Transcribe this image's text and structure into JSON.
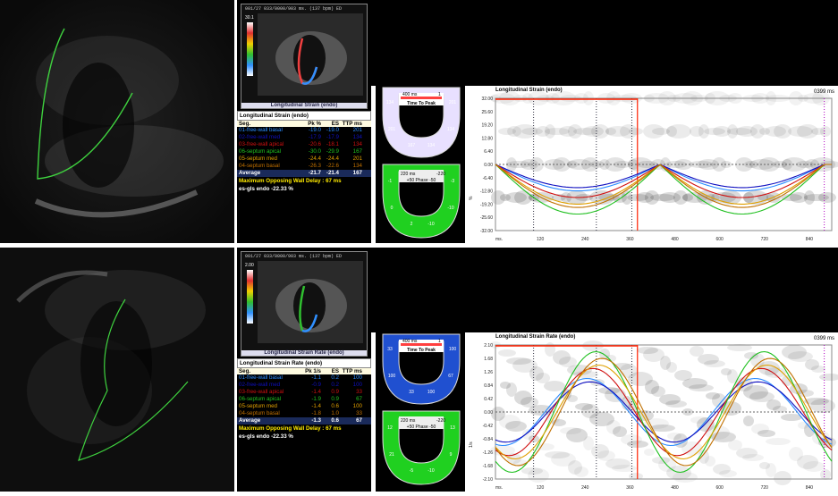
{
  "top": {
    "header": "001/27 033/0000/903 ms. (137 bpm) ED",
    "scale_label": "30.1",
    "thumb_caption": "Longitudinal Strain (endo)",
    "table": {
      "title": "Longitudinal Strain (endo)",
      "headers": [
        "Seg.",
        "Pk %",
        "ES",
        "TTP ms"
      ],
      "rows": [
        {
          "seg": "01-free-wall basal",
          "pk": "-19.0",
          "es": "-19.0",
          "ttp": "201",
          "color": "#2a8cff"
        },
        {
          "seg": "02-free-wall med",
          "pk": "-17.9",
          "es": "-17.9",
          "ttp": "134",
          "color": "#1010c0"
        },
        {
          "seg": "03-free-wall apical",
          "pk": "-20.6",
          "es": "-18.1",
          "ttp": "134",
          "color": "#d01010"
        },
        {
          "seg": "06-septum apical",
          "pk": "-30.0",
          "es": "-29.9",
          "ttp": "167",
          "color": "#20c020"
        },
        {
          "seg": "05-septum med",
          "pk": "-24.4",
          "es": "-24.4",
          "ttp": "201",
          "color": "#e0a000"
        },
        {
          "seg": "04-septum basal",
          "pk": "-26.3",
          "es": "-22.6",
          "ttp": "134",
          "color": "#c07000"
        }
      ],
      "average": {
        "label": "Average",
        "pk": "-21.7",
        "es": "-21.4",
        "ttp": "167"
      },
      "delay": "Maximum Opposing Wall Delay : 67 ms",
      "gls": "es-gls endo -22.33 %"
    },
    "bullseye1": {
      "left_label": "400 ms",
      "right_label": "1",
      "center": "Time To Peak",
      "values": [
        "134",
        "201",
        "201",
        "134",
        "167",
        "134"
      ]
    },
    "bullseye2": {
      "left_label": "220 ms",
      "right_label": "-220",
      "center": "+50 Phase -50",
      "values": [
        "-1",
        "-3",
        "0",
        "-10",
        "2",
        "-10"
      ]
    },
    "graph_title": "Longitudinal Strain (endo)",
    "graph_time": "0399 ms",
    "unit": "%",
    "x_unit": "ms.",
    "y_ticks": [
      "32.00",
      "25.60",
      "19.20",
      "12.80",
      "6.40",
      "0.00",
      "-6.40",
      "-12.80",
      "-19.20",
      "-25.60",
      "-32.00"
    ],
    "x_ticks": [
      "120",
      "240",
      "360",
      "480",
      "600",
      "720",
      "840"
    ]
  },
  "bottom": {
    "header": "001/27 033/0000/903 ms. (137 bpm) ED",
    "scale_label": "2.00",
    "thumb_caption": "Longitudinal Strain Rate (endo)",
    "table": {
      "title": "Longitudinal Strain Rate (endo)",
      "headers": [
        "Seg.",
        "Pk 1/s",
        "ES",
        "TTP ms"
      ],
      "rows": [
        {
          "seg": "01-free-wall basal",
          "pk": "-1.1",
          "es": "0.2",
          "ttp": "100",
          "color": "#2a8cff"
        },
        {
          "seg": "02-free-wall med",
          "pk": "-0.9",
          "es": "0.2",
          "ttp": "100",
          "color": "#1010c0"
        },
        {
          "seg": "03-free-wall apical",
          "pk": "-1.4",
          "es": "0.9",
          "ttp": "33",
          "color": "#d01010"
        },
        {
          "seg": "06-septum apical",
          "pk": "-1.9",
          "es": "0.9",
          "ttp": "67",
          "color": "#20c020"
        },
        {
          "seg": "05-septum med",
          "pk": "-1.4",
          "es": "0.6",
          "ttp": "100",
          "color": "#e0a000"
        },
        {
          "seg": "04-septum basal",
          "pk": "-1.8",
          "es": "1.0",
          "ttp": "33",
          "color": "#c07000"
        }
      ],
      "average": {
        "label": "Average",
        "pk": "-1.3",
        "es": "0.6",
        "ttp": "67"
      },
      "delay": "Maximum Opposing Wall Delay : 67 ms",
      "gls": "es-gls endo -22.33 %"
    },
    "bullseye1": {
      "left_label": "400 ms",
      "right_label": "1",
      "center": "Time To Peak",
      "values": [
        "33",
        "100",
        "100",
        "67",
        "33",
        "100"
      ]
    },
    "bullseye2": {
      "left_label": "220 ms",
      "right_label": "-220",
      "center": "+50 Phase -50",
      "values": [
        "12",
        "13",
        "21",
        "9",
        "-5",
        "-10"
      ]
    },
    "graph_title": "Longitudinal Strain Rate (endo)",
    "graph_time": "0399 ms",
    "unit": "1/s",
    "x_unit": "ms.",
    "y_ticks": [
      "2.10",
      "1.68",
      "1.26",
      "0.84",
      "0.42",
      "0.00",
      "-0.42",
      "-0.84",
      "-1.26",
      "-1.68",
      "-2.10"
    ],
    "x_ticks": [
      "120",
      "240",
      "360",
      "480",
      "600",
      "720",
      "840"
    ]
  },
  "colors": {
    "blue": "#2a8cff",
    "navy": "#1010c0",
    "red": "#d01010",
    "green": "#20c020",
    "yellow": "#e0a000",
    "orange": "#c07000",
    "accent": "#ff2000"
  }
}
